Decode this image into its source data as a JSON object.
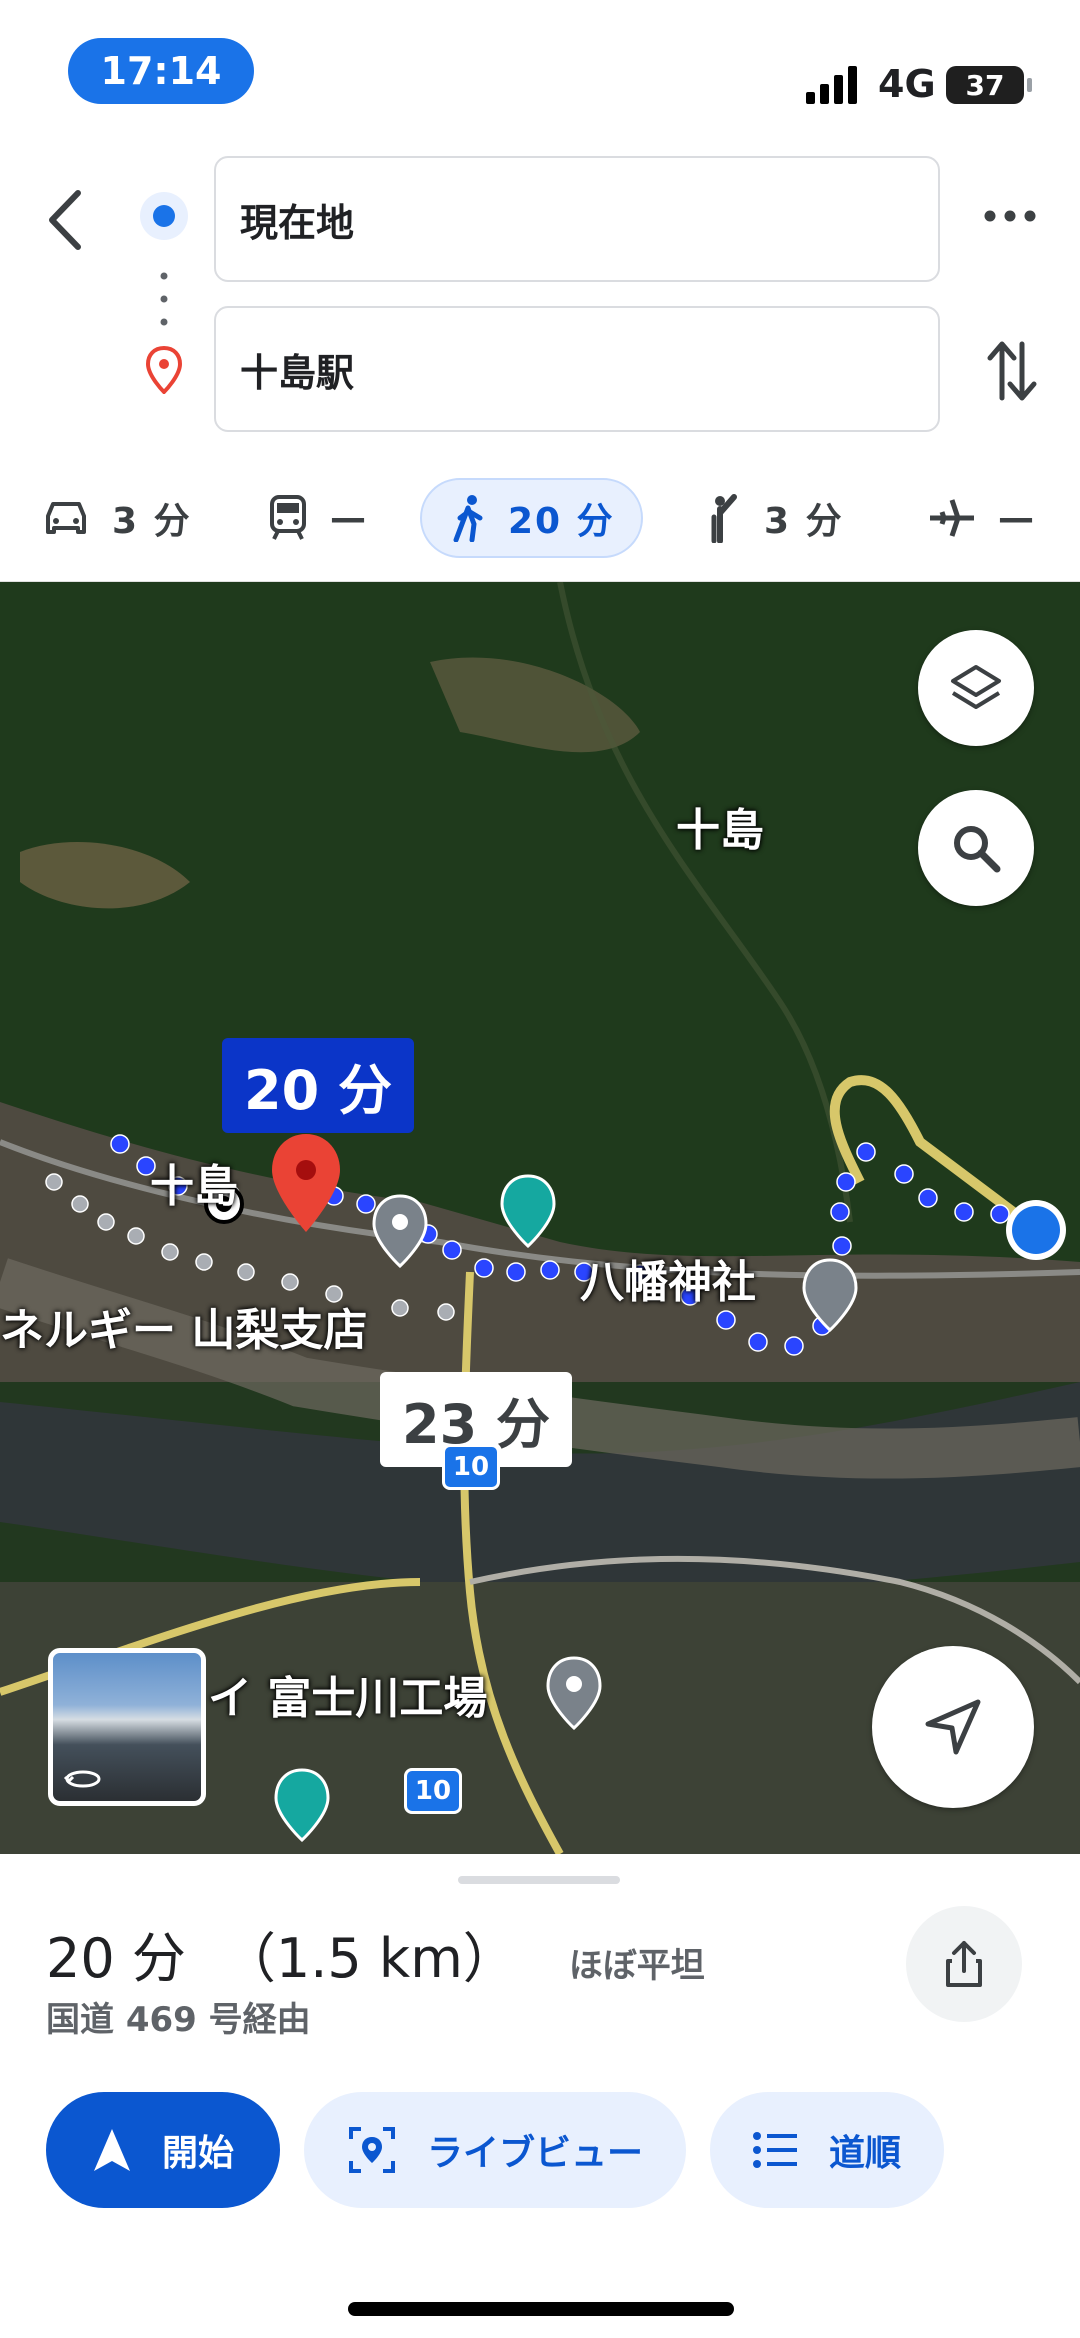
{
  "status_bar": {
    "time": "17:14",
    "network": "4G",
    "battery": "37"
  },
  "route_inputs": {
    "origin": "現在地",
    "destination": "十島駅"
  },
  "modes": [
    {
      "name": "car",
      "value": "3 分"
    },
    {
      "name": "transit",
      "value": "—"
    },
    {
      "name": "walk",
      "value": "20 分",
      "active": true
    },
    {
      "name": "ride",
      "value": "3 分"
    },
    {
      "name": "flight",
      "value": "—"
    }
  ],
  "map": {
    "labels": {
      "area": "十島",
      "station": "十島",
      "shrine": "八幡神社",
      "company_left": "ネルギー 山梨支店",
      "factory": "イ 富士川工場"
    },
    "route_time_primary": "20 分",
    "route_time_alt": "23 分",
    "road_number_1": "10",
    "road_number_2": "10"
  },
  "summary": {
    "duration": "20 分",
    "distance": "（1.5 km）",
    "terrain": "ほぼ平坦",
    "via": "国道 469 号経由"
  },
  "actions": {
    "start": "開始",
    "live_view": "ライブビュー",
    "steps": "道順"
  },
  "colors": {
    "accent": "#0b57d0",
    "route": "#1a3cff",
    "pin": "#ea4335"
  }
}
